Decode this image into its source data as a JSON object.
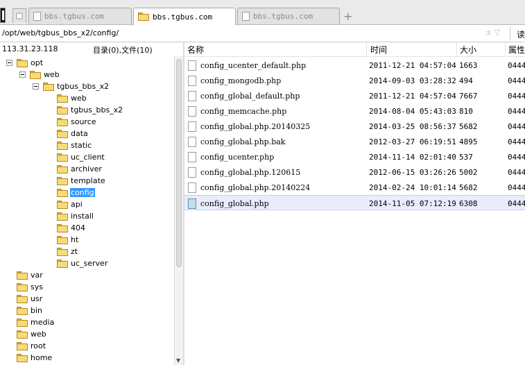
{
  "tabs": [
    {
      "label": "bbs.tgbus.com",
      "active": false,
      "icon": "page-icon"
    },
    {
      "label": "bbs.tgbus.com",
      "active": true,
      "icon": "folder-icon"
    },
    {
      "label": "bbs.tgbus.com",
      "active": false,
      "icon": "page-icon"
    }
  ],
  "new_tab_symbol": "+",
  "address": {
    "path": "/opt/web/tgbus_bbs_x2/config/",
    "arrows": "± ▽",
    "button_label": "读"
  },
  "left_panel": {
    "ip": "113.31.23.118",
    "counts": "目录(0),文件(10)"
  },
  "tree": [
    {
      "label": "opt",
      "level": 0,
      "expanded": true
    },
    {
      "label": "web",
      "level": 1,
      "expanded": true
    },
    {
      "label": "tgbus_bbs_x2",
      "level": 2,
      "expanded": true
    },
    {
      "label": "web",
      "level": 3
    },
    {
      "label": "tgbus_bbs_x2",
      "level": 3
    },
    {
      "label": "source",
      "level": 3
    },
    {
      "label": "data",
      "level": 3
    },
    {
      "label": "static",
      "level": 3
    },
    {
      "label": "uc_client",
      "level": 3
    },
    {
      "label": "archiver",
      "level": 3
    },
    {
      "label": "template",
      "level": 3
    },
    {
      "label": "config",
      "level": 3,
      "selected": true
    },
    {
      "label": "api",
      "level": 3
    },
    {
      "label": "install",
      "level": 3
    },
    {
      "label": "404",
      "level": 3
    },
    {
      "label": "ht",
      "level": 3
    },
    {
      "label": "zt",
      "level": 3
    },
    {
      "label": "uc_server",
      "level": 3
    },
    {
      "label": "var",
      "level": 1
    },
    {
      "label": "sys",
      "level": 1
    },
    {
      "label": "usr",
      "level": 1
    },
    {
      "label": "bin",
      "level": 1
    },
    {
      "label": "media",
      "level": 1
    },
    {
      "label": "web",
      "level": 1
    },
    {
      "label": "root",
      "level": 1
    },
    {
      "label": "home",
      "level": 1
    }
  ],
  "table": {
    "columns": [
      "名称",
      "时间",
      "大小",
      "属性"
    ],
    "rows": [
      {
        "name": "config_ucenter_default.php",
        "time": "2011-12-21 04:57:04",
        "size": "1663",
        "attr": "0444"
      },
      {
        "name": "config_mongodb.php",
        "time": "2014-09-03 03:28:32",
        "size": "494",
        "attr": "0444"
      },
      {
        "name": "config_global_default.php",
        "time": "2011-12-21 04:57:04",
        "size": "7667",
        "attr": "0444"
      },
      {
        "name": "config_memcache.php",
        "time": "2014-08-04 05:43:03",
        "size": "810",
        "attr": "0444"
      },
      {
        "name": "config_global.php.20140325",
        "time": "2014-03-25 08:56:37",
        "size": "5682",
        "attr": "0444"
      },
      {
        "name": "config_global.php.bak",
        "time": "2012-03-27 06:19:51",
        "size": "4895",
        "attr": "0444"
      },
      {
        "name": "config_ucenter.php",
        "time": "2014-11-14 02:01:40",
        "size": "537",
        "attr": "0444"
      },
      {
        "name": "config_global.php.120615",
        "time": "2012-06-15 03:26:26",
        "size": "5002",
        "attr": "0444"
      },
      {
        "name": "config_global.php.20140224",
        "time": "2014-02-24 10:01:14",
        "size": "5682",
        "attr": "0444"
      },
      {
        "name": "config_global.php",
        "time": "2014-11-05 07:12:19",
        "size": "6308",
        "attr": "0444",
        "selected": true
      }
    ]
  }
}
